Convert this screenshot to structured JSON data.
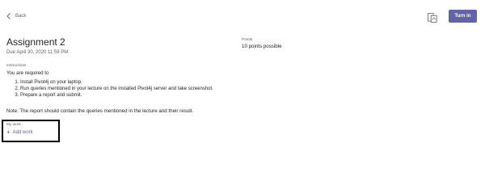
{
  "header": {
    "back_label": "Back",
    "turn_in_label": "Turn in"
  },
  "assignment": {
    "title": "Assignment 2",
    "due": "Due April 30, 2020 11:59 PM",
    "points_label": "Points",
    "points_value": "10 points possible",
    "instructions_label": "Instructions",
    "instructions_intro": "You are required to",
    "steps": [
      "Install Pivot4j on your laptop.",
      "Run queries mentioned in your lecture on the installed Pivot4j server and take screenshot.",
      "Prepare a report and submit."
    ],
    "note": "Note: The report should contain the queries mentioned in the lecture and their result."
  },
  "my_work": {
    "label": "My work",
    "add_work_label": "Add work"
  },
  "colors": {
    "accent": "#6264a7"
  }
}
